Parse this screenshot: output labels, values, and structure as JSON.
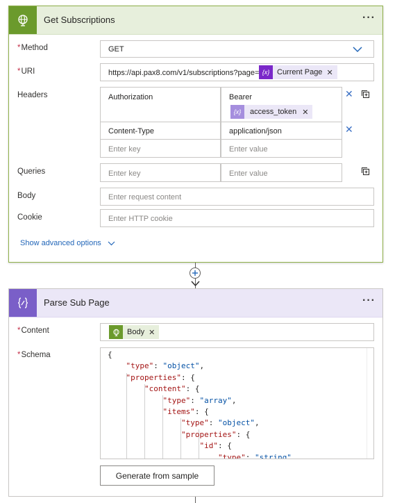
{
  "get_subscriptions": {
    "title": "Get Subscriptions",
    "more": "···",
    "method": {
      "label": "Method",
      "value": "GET"
    },
    "uri": {
      "label": "URI",
      "value": "https://api.pax8.com/v1/subscriptions?page=",
      "token": "Current Page"
    },
    "headers": {
      "label": "Headers",
      "rows": [
        {
          "key": "Authorization",
          "value": "Bearer",
          "token": "access_token"
        },
        {
          "key": "Content-Type",
          "value": "application/json"
        }
      ],
      "key_placeholder": "Enter key",
      "value_placeholder": "Enter value"
    },
    "queries": {
      "label": "Queries",
      "key_placeholder": "Enter key",
      "value_placeholder": "Enter value"
    },
    "body": {
      "label": "Body",
      "placeholder": "Enter request content"
    },
    "cookie": {
      "label": "Cookie",
      "placeholder": "Enter HTTP cookie"
    },
    "advanced": "Show advanced options"
  },
  "parse_sub_page": {
    "title": "Parse Sub Page",
    "more": "···",
    "content": {
      "label": "Content",
      "token": "Body"
    },
    "schema": {
      "label": "Schema",
      "lines": [
        "{",
        "    \"type\": \"object\",",
        "    \"properties\": {",
        "        \"content\": {",
        "            \"type\": \"array\",",
        "            \"items\": {",
        "                \"type\": \"object\",",
        "                \"properties\": {",
        "                    \"id\": {",
        "                        \"type\": \"string\""
      ]
    },
    "generate_button": "Generate from sample"
  },
  "colors": {
    "http_accent": "#6b9a2c",
    "parse_accent": "#7a5fc8",
    "expression_token": "#7a28c9",
    "link": "#2266b8"
  },
  "icons": {
    "http": "globe-icon",
    "parse": "braces-icon",
    "token_expr": "fx-icon",
    "token_http": "globe-icon"
  }
}
